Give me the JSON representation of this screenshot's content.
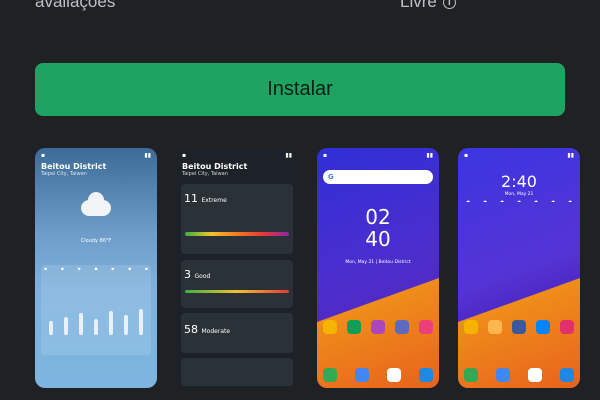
{
  "info_row": {
    "reviews_label": "avaliações",
    "age_rating": "Livre",
    "info_icon": "info-icon"
  },
  "install_button": {
    "label": "Instalar",
    "color": "#1ea362"
  },
  "screenshots": [
    {
      "name": "weather-current",
      "location": "Beitou District",
      "sublocation": "Taipei City, Taiwan",
      "condition": "Cloudy 86°F"
    },
    {
      "name": "weather-uv-air",
      "location": "Beitou District",
      "sublocation": "Taipei City, Taiwan",
      "uv_value": "11",
      "uv_label": "Extreme",
      "pm_value": "3",
      "pm_label": "Good",
      "aq_value": "58",
      "aq_label": "Moderate"
    },
    {
      "name": "home-clock",
      "hour": "02",
      "minute": "40",
      "date": "Mon, May 21  |  Beitou District"
    },
    {
      "name": "home-widget",
      "time": "2:40",
      "date": "Mon, May 21"
    }
  ]
}
